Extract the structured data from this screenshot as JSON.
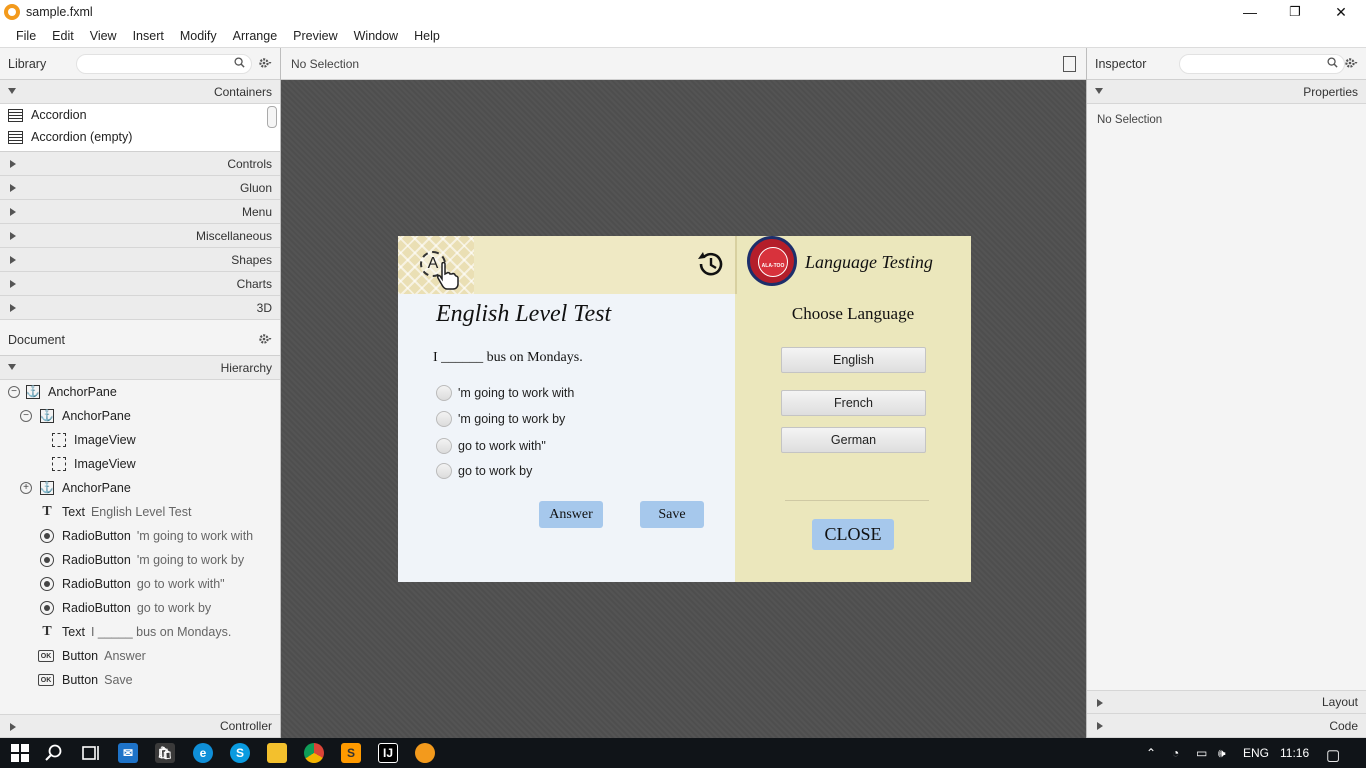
{
  "window": {
    "title": "sample.fxml",
    "minimize": "—",
    "restore": "❐",
    "close": "✕"
  },
  "menubar": [
    "File",
    "Edit",
    "View",
    "Insert",
    "Modify",
    "Arrange",
    "Preview",
    "Window",
    "Help"
  ],
  "library": {
    "label": "Library",
    "sections": {
      "containers": "Containers",
      "controls": "Controls",
      "gluon": "Gluon",
      "menu": "Menu",
      "misc": "Miscellaneous",
      "shapes": "Shapes",
      "charts": "Charts",
      "threeD": "3D"
    },
    "items": [
      "Accordion",
      "Accordion  (empty)"
    ]
  },
  "document": {
    "label": "Document",
    "hierarchy_label": "Hierarchy",
    "controller_label": "Controller",
    "tree": [
      {
        "type": "AnchorPane",
        "value": ""
      },
      {
        "type": "AnchorPane",
        "value": ""
      },
      {
        "type": "ImageView",
        "value": ""
      },
      {
        "type": "ImageView",
        "value": ""
      },
      {
        "type": "AnchorPane",
        "value": ""
      },
      {
        "type": "Text",
        "value": "English Level Test"
      },
      {
        "type": "RadioButton",
        "value": "'m going to work with"
      },
      {
        "type": "RadioButton",
        "value": "'m going to work by"
      },
      {
        "type": "RadioButton",
        "value": "go to work with\""
      },
      {
        "type": "RadioButton",
        "value": "go to work by"
      },
      {
        "type": "Text",
        "value": "I _____ bus on Mondays."
      },
      {
        "type": "Button",
        "value": "Answer"
      },
      {
        "type": "Button",
        "value": "Save"
      }
    ]
  },
  "center": {
    "selection": "No Selection"
  },
  "app": {
    "header_title": "Language Testing",
    "seal_text": "ALA-TOO",
    "test_title": "English Level Test",
    "question": "I ______ bus on Mondays.",
    "options": [
      "'m going to work with",
      "'m going to work by",
      "go to work with\"",
      "go to work by"
    ],
    "answer_btn": "Answer",
    "save_btn": "Save",
    "choose_label": "Choose Language",
    "languages": [
      "English",
      "French",
      "German"
    ],
    "close_btn": "CLOSE"
  },
  "inspector": {
    "label": "Inspector",
    "properties": "Properties",
    "selection": "No Selection",
    "layout": "Layout",
    "code": "Code"
  },
  "taskbar": {
    "lang": "ENG",
    "time": "11:16"
  }
}
